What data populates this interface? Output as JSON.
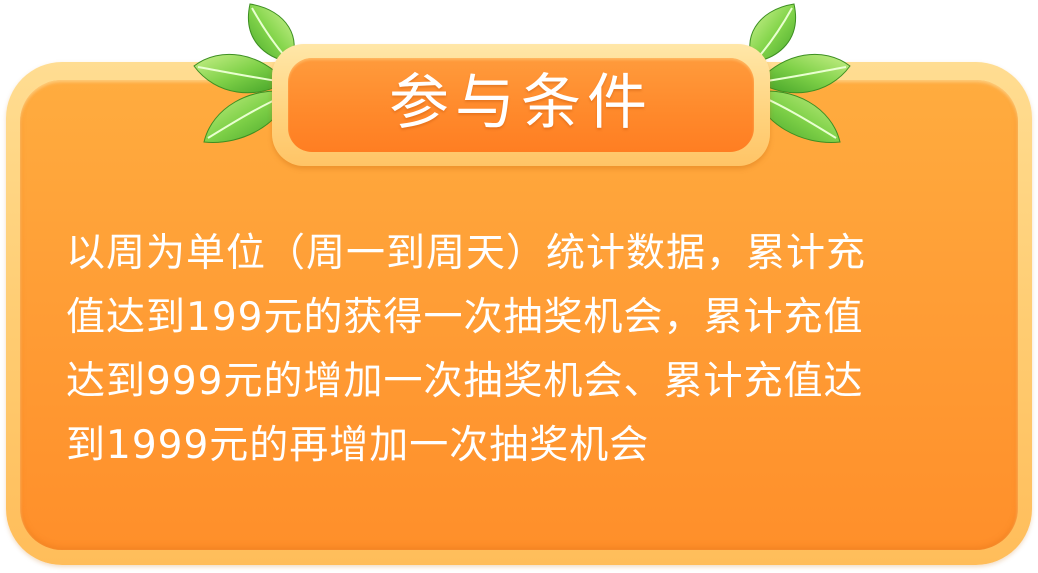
{
  "card": {
    "title": "参与条件",
    "lines": [
      "以周为单位（周一到周天）统计数据，累计充",
      "值达到199元的获得一次抽奖机会，累计充值",
      "达到999元的增加一次抽奖机会、累计充值达",
      "到1999元的再增加一次抽奖机会"
    ]
  },
  "decor": {
    "leaf_icons": [
      "leaf-icon",
      "leaf-icon"
    ]
  },
  "colors": {
    "panel_orange": "#ff9e36",
    "frame_light": "#ffcd73",
    "leaf_green": "#6cc63a",
    "text": "#ffffff"
  }
}
